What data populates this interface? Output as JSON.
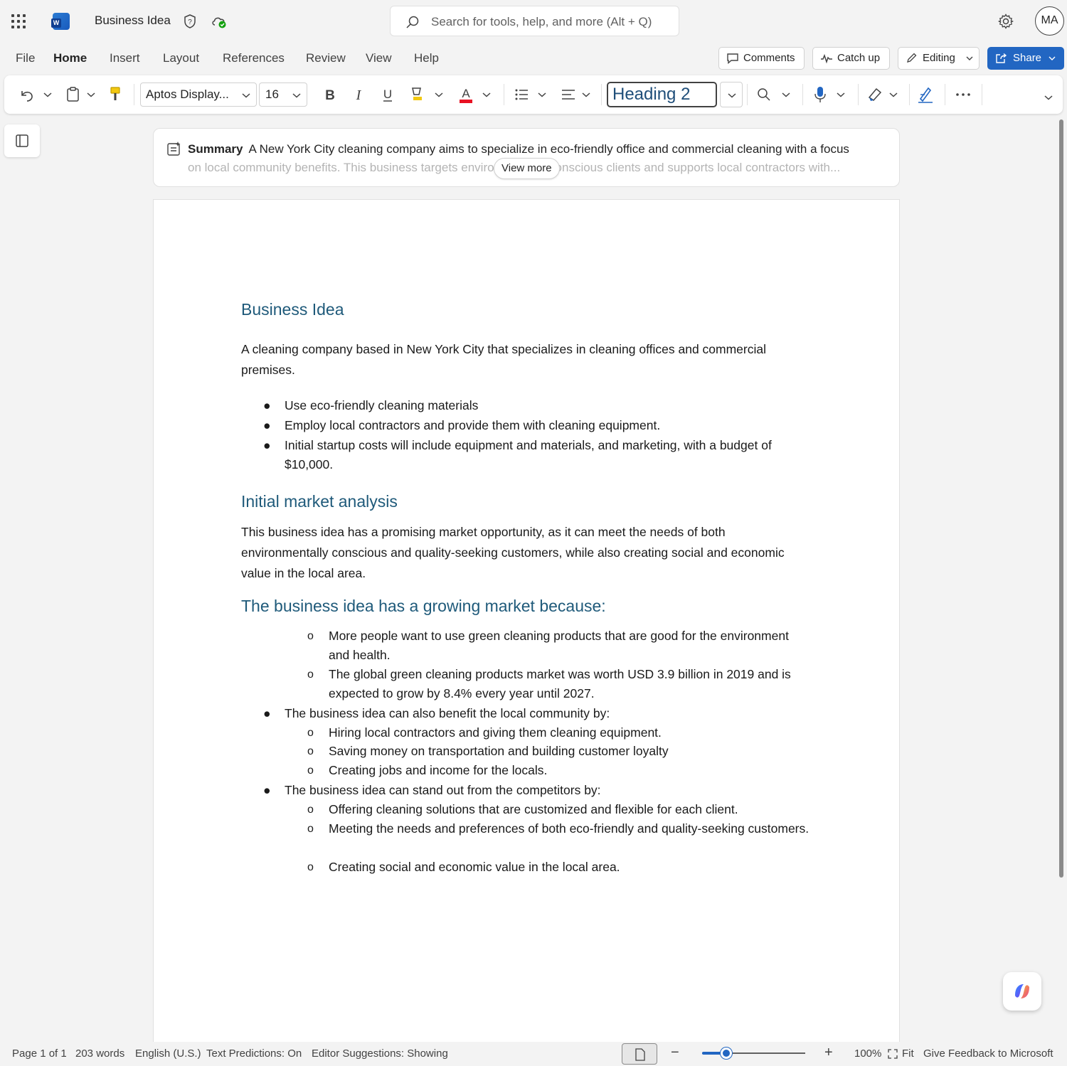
{
  "titlebar": {
    "doc_title": "Business Idea",
    "search_placeholder": "Search for tools, help, and more (Alt + Q)",
    "avatar_initials": "MA"
  },
  "menubar": {
    "tabs": [
      "File",
      "Home",
      "Insert",
      "Layout",
      "References",
      "Review",
      "View",
      "Help"
    ],
    "active_tab": "Home",
    "comments_label": "Comments",
    "catchup_label": "Catch up",
    "editing_label": "Editing",
    "share_label": "Share"
  },
  "ribbon": {
    "font_name": "Aptos Display...",
    "font_size": "16",
    "style_name": "Heading 2",
    "font_color": "#e81123",
    "icons": [
      "undo-icon",
      "paste-icon",
      "format-painter-icon",
      "bold-icon",
      "italic-icon",
      "underline-icon",
      "highlight-icon",
      "font-color-icon",
      "bullets-icon",
      "align-icon",
      "find-icon",
      "dictate-icon",
      "sensitivity-icon",
      "editor-icon",
      "more-icon",
      "collapse-icon"
    ]
  },
  "summary": {
    "label": "Summary",
    "line1": "A New York City cleaning company aims to specialize in eco-friendly office and commercial cleaning with a focus",
    "line2": "on local community benefits. This business targets environmentally conscious clients and supports local contractors with...",
    "view_more": "View more"
  },
  "document": {
    "heading1": "Business Idea",
    "intro": "A cleaning company based in New York City that specializes in cleaning offices and commercial premises.",
    "bullets1": [
      "Use eco-friendly cleaning materials",
      "Employ local contractors and provide them with cleaning equipment.",
      "Initial startup costs will include equipment and materials, and marketing, with a budget of $10,000."
    ],
    "heading2": "Initial market analysis",
    "analysis": "This business idea has a promising market opportunity, as it can meet the needs of both environmentally conscious and quality-seeking customers, while also creating social and economic value in the local area.",
    "heading3": "The business idea has a growing market because:",
    "growing_sub": [
      "More people want to use green cleaning products that are good for the environment and health.",
      "The global green cleaning products market was worth USD 3.9 billion in 2019 and is expected to grow by 8.4% every year until 2027."
    ],
    "community_bullet": "The business idea can also benefit the local community by:",
    "community_sub": [
      "Hiring local contractors and giving them cleaning equipment.",
      "Saving money on transportation and building customer loyalty",
      "Creating jobs and income for the locals."
    ],
    "standout_bullet": "The business idea can stand out from the competitors by:",
    "standout_sub": [
      "Offering cleaning solutions that are customized and flexible for each client.",
      "Meeting the needs and preferences of both eco-friendly and quality-seeking customers.",
      "Creating social and economic value in the local area."
    ]
  },
  "statusbar": {
    "page": "Page 1 of 1",
    "words": "203 words",
    "language": "English (U.S.)",
    "text_predictions": "Text Predictions: On",
    "editor_suggestions": "Editor Suggestions: Showing",
    "zoom": "100%",
    "zoom_level_percent": 100,
    "fit": "Fit",
    "feedback": "Give Feedback to Microsoft"
  },
  "colors": {
    "accent": "#2266c2",
    "heading": "#1f5a7a"
  }
}
